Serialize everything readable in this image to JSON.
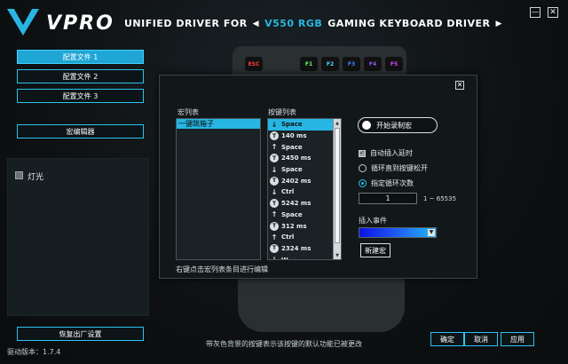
{
  "header": {
    "brand": "VPRO",
    "title_prefix": "UNIFIED DRIVER FOR",
    "model": "V550 RGB",
    "title_suffix": "GAMING KEYBOARD DRIVER",
    "prev_arrow": "◀",
    "next_arrow": "▶",
    "minimize": "—",
    "close": "✕"
  },
  "sidebar": {
    "profiles": [
      "配置文件 1",
      "配置文件 2",
      "配置文件 3"
    ],
    "macro_editor": "宏编辑器",
    "light_label": "灯光",
    "reset": "恢复出厂设置",
    "version": "驱动版本：1.7.4"
  },
  "keyboard": {
    "keys": [
      "ESC",
      "F1",
      "F2",
      "F3",
      "F4",
      "F5"
    ]
  },
  "footer": {
    "hint": "带灰色背景的按键表示该按键的默认功能已被更改",
    "ok": "确定",
    "cancel": "取消",
    "apply": "应用"
  },
  "dialog": {
    "close": "✕",
    "macro_list_label": "宏列表",
    "key_list_label": "按键列表",
    "macro_items": [
      "一键跳箱子"
    ],
    "key_events": [
      {
        "icon": "down",
        "text": "Space"
      },
      {
        "icon": "timer",
        "text": "140 ms"
      },
      {
        "icon": "up",
        "text": "Space"
      },
      {
        "icon": "timer",
        "text": "2450 ms"
      },
      {
        "icon": "down",
        "text": "Space"
      },
      {
        "icon": "timer",
        "text": "2402 ms"
      },
      {
        "icon": "down",
        "text": "Ctrl"
      },
      {
        "icon": "timer",
        "text": "5242 ms"
      },
      {
        "icon": "up",
        "text": "Space"
      },
      {
        "icon": "timer",
        "text": "312 ms"
      },
      {
        "icon": "up",
        "text": "Ctrl"
      },
      {
        "icon": "timer",
        "text": "2324 ms"
      },
      {
        "icon": "down",
        "text": "W"
      }
    ],
    "record_label": "开始录制宏",
    "auto_insert_delay": "自动插入延时",
    "loop_until_release": "循环直到按键松开",
    "loop_count_label": "指定循环次数",
    "loop_count_value": "1",
    "loop_range": "1 ~ 65535",
    "insert_event_label": "插入事件",
    "new_macro": "新建宏",
    "hint": "右键点击宏列表条目进行编辑"
  },
  "colors": {
    "accent": "#27b6e4",
    "background": "#0f1213",
    "dialog_bg": "#121819"
  }
}
